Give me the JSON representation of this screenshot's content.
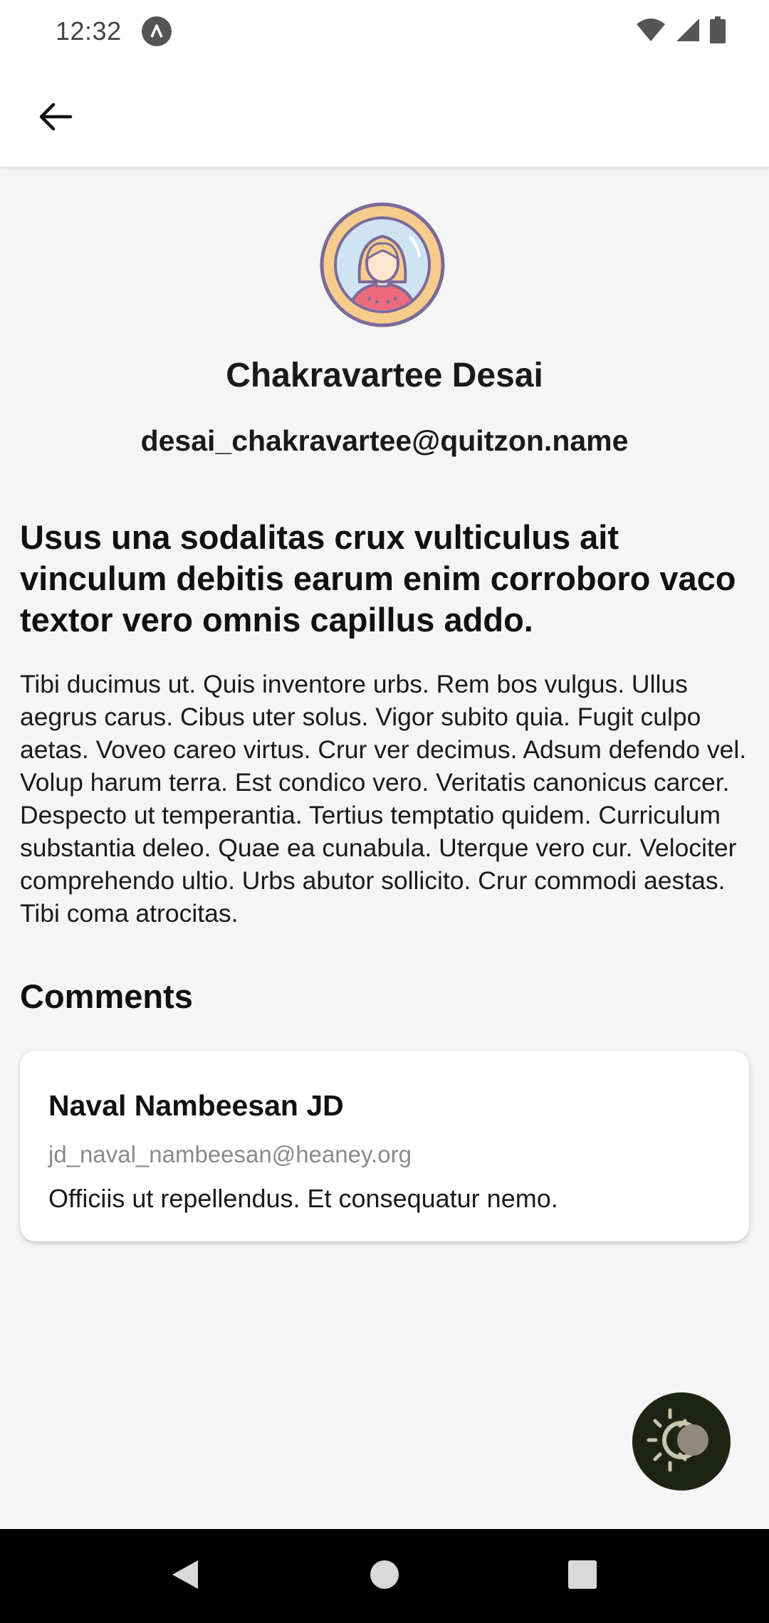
{
  "status_bar": {
    "time": "12:32",
    "app_icon": "app-notification-icon",
    "icons": [
      "wifi-icon",
      "signal-icon",
      "battery-icon"
    ]
  },
  "app_bar": {
    "back_icon": "back-arrow-icon"
  },
  "profile": {
    "avatar_icon": "user-avatar",
    "name": "Chakravartee Desai",
    "email": "desai_chakravartee@quitzon.name"
  },
  "post": {
    "title": "Usus una sodalitas crux vulticulus ait vinculum debitis earum enim corroboro vaco textor vero omnis capillus addo.",
    "body": "Tibi ducimus ut. Quis inventore urbs. Rem bos vulgus. Ullus aegrus carus. Cibus uter solus. Vigor subito quia. Fugit culpo aetas. Voveo careo virtus. Crur ver decimus. Adsum defendo vel. Volup harum terra. Est condico vero. Veritatis canonicus carcer. Despecto ut temperantia. Tertius temptatio quidem. Curriculum substantia deleo. Quae ea cunabula. Uterque vero cur. Velociter comprehendo ultio. Urbs abutor sollicito. Crur commodi aestas. Tibi coma atrocitas."
  },
  "comments": {
    "heading": "Comments",
    "items": [
      {
        "name": "Naval Nambeesan JD",
        "email": "jd_naval_nambeesan@heaney.org",
        "body": "Officiis ut repellendus. Et consequatur nemo."
      }
    ]
  },
  "fab": {
    "icon": "theme-toggle-icon"
  },
  "nav_bar": {
    "icons": [
      "nav-back-icon",
      "nav-home-icon",
      "nav-recents-icon"
    ]
  },
  "colors": {
    "background": "#f5f5f5",
    "surface": "#ffffff",
    "fab": "#1e2411",
    "secondary_text": "#8a8a8a"
  }
}
